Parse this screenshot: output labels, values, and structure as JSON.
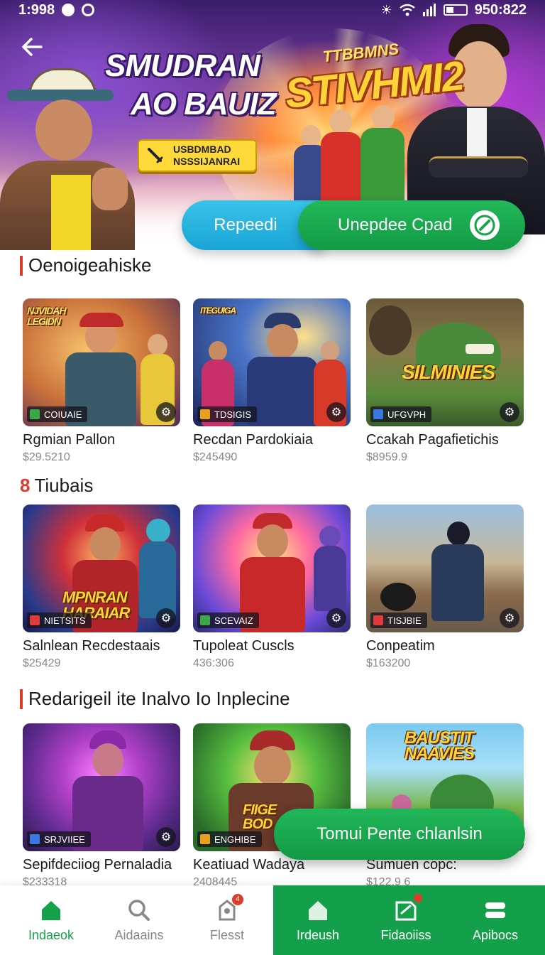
{
  "status_bar": {
    "time": "1:998",
    "battery": "950:822"
  },
  "hero": {
    "title_left_line1": "SMUDRAN",
    "title_left_line2": "AO BAUIZ",
    "title_right_small": "TTBBMNS",
    "title_right_big": "STIVHMI2",
    "tag_line1": "USBDMBAD",
    "tag_line2": "NSSSIJANRAI",
    "cta_left": "Repeedi",
    "cta_right": "Unepdee Cpad"
  },
  "sections": [
    {
      "title": "Oenoigeahiske",
      "number": "",
      "cards": [
        {
          "name": "Rgmian Pallon",
          "price": "$29.5210",
          "badge": "COIUAIE",
          "art_text": "NJVIDAH LEGIDN",
          "badge_color": "#3aa84a"
        },
        {
          "name": "Recdan Pardokiaia",
          "price": "$245490",
          "badge": "TDSIGIS",
          "art_text": "ITEGUIGA",
          "badge_color": "#e8a020"
        },
        {
          "name": "Ccakah Pagafietichis",
          "price": "$8959.9",
          "badge": "UFGVPH",
          "art_text": "SILMINIES",
          "badge_color": "#3a78e0"
        }
      ]
    },
    {
      "title": "Tiubais",
      "number": "8",
      "cards": [
        {
          "name": "Salnlean Recdestaais",
          "price": "$25429",
          "badge": "NIETSITS",
          "art_text": "MPNRAN HARAIAR",
          "badge_color": "#e03a3a"
        },
        {
          "name": "Tupoleat Cuscls",
          "price": "436:306",
          "badge": "SCEVAIZ",
          "art_text": "",
          "badge_color": "#3aa84a"
        },
        {
          "name": "Conpeatim",
          "price": "$163200",
          "badge": "TISJBIE",
          "art_text": "",
          "badge_color": "#e03a3a"
        }
      ]
    },
    {
      "title": "Redarigeil ite Inalvo Io Inplecine",
      "number": "",
      "cards": [
        {
          "name": "Sepifdeciiog Pernaladia",
          "price": "$233318",
          "badge": "SRJVIIEE",
          "art_text": "",
          "badge_color": "#3a78e0"
        },
        {
          "name": "Keatiuad Wadaya",
          "price": "2408445",
          "badge": "ENGHIBE",
          "art_text": "FIIGE BOD",
          "badge_color": "#e8a020"
        },
        {
          "name": "Sumuen copc:",
          "price": "$122.9 6",
          "badge": "",
          "art_text": "BAUSTIT NAAVIES",
          "badge_color": "#3a78e0"
        }
      ]
    }
  ],
  "floating_button": "Tomui Pente chlanlsin",
  "bottom_nav": [
    {
      "label": "Indaeok",
      "icon": "home-icon",
      "active": true
    },
    {
      "label": "Aidaains",
      "icon": "search-icon",
      "active": false
    },
    {
      "label": "Flesst",
      "icon": "notifications-icon",
      "badge": "4",
      "active": false
    },
    {
      "label": "Irdeush",
      "icon": "home-outline-icon",
      "active": false
    },
    {
      "label": "Fidaoiiss",
      "icon": "tickets-icon",
      "badge": "",
      "active": false
    },
    {
      "label": "Apibocs",
      "icon": "menu-icon",
      "active": false
    }
  ],
  "colors": {
    "accent_green": "#14a04a",
    "accent_blue": "#1aa4d6",
    "section_marker": "#e03a2a"
  }
}
